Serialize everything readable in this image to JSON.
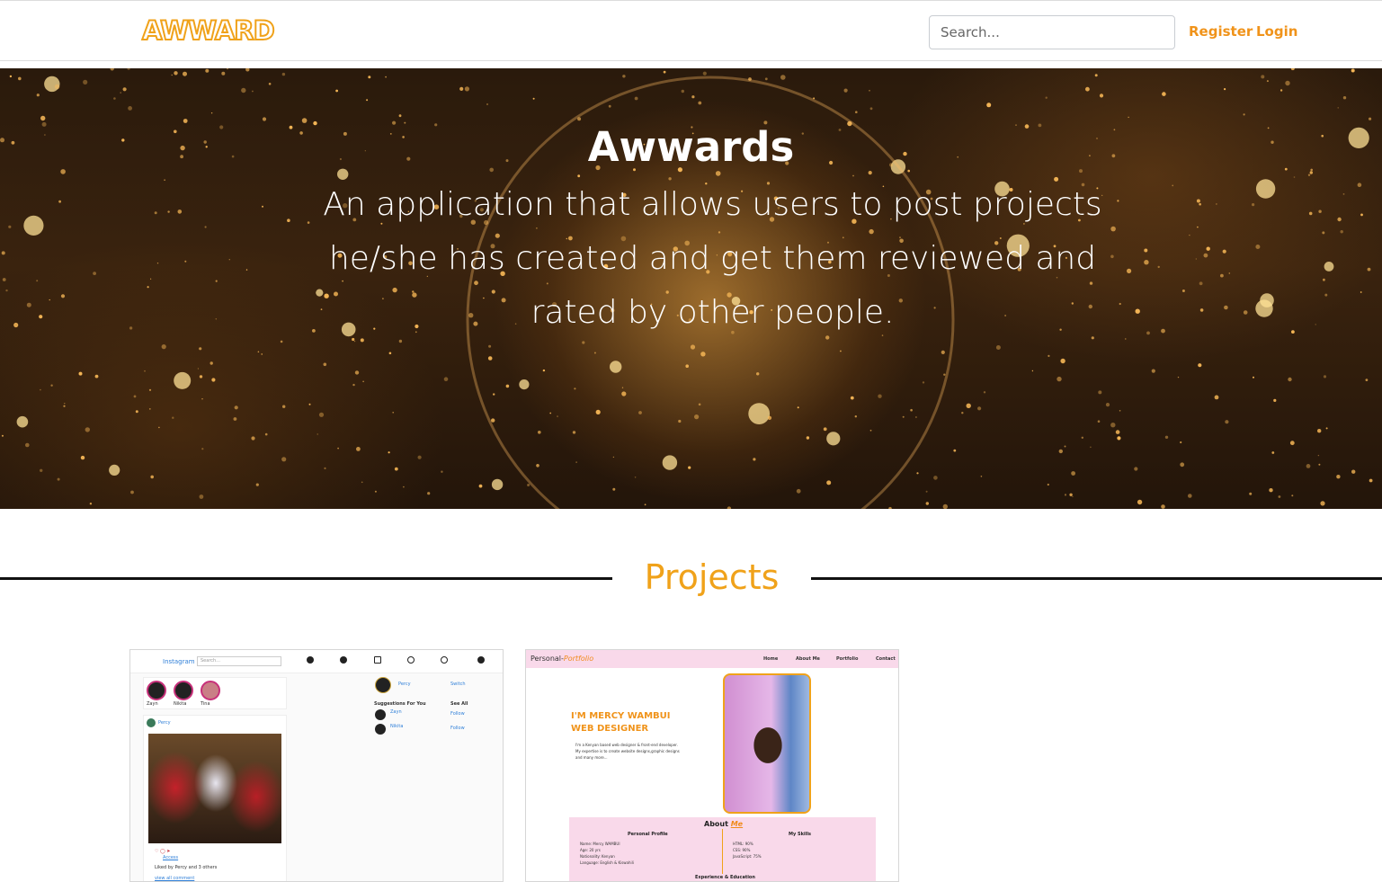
{
  "navbar": {
    "logo": "AWWARD",
    "search_placeholder": "Search...",
    "register": "Register",
    "login": "Login"
  },
  "hero": {
    "title": "Awwards",
    "description": "An application that allows users to post projects he/she has created and get them reviewed and rated by other people."
  },
  "projects": {
    "title": "Projects"
  },
  "cards": [
    {
      "brand": "Instagram",
      "search": "Search...",
      "stories": [
        "Zayn",
        "Nikita",
        "Tina"
      ],
      "post_user": "Percy",
      "side_user": "Percy",
      "side_switch": "Switch",
      "suggestions": "Suggestions For You",
      "see_all": "See All",
      "sugg_1": "Zayn",
      "sugg_2": "Nikita",
      "follow": "Follow",
      "caption_user": "Access",
      "liked_by": "Liked by Percy and 3 others",
      "view_all": "view all comment"
    },
    {
      "brand_a": "Personal-",
      "brand_b": "Portfolio",
      "nav": [
        "Home",
        "About Me",
        "Portfolio",
        "Contact"
      ],
      "heading_1": "I'M MERCY WAMBUI",
      "heading_2": "WEB DESIGNER",
      "intro": "I'm a Kenyan based web designer & front-end developer. My expertise is to create website designs,graphic designs and many more...",
      "about_a": "About ",
      "about_b": "Me",
      "personal_profile": "Personal Profile",
      "my_skills": "My Skills",
      "profile_lines": [
        "Name: Mercy WAMBUI",
        "Age: 20 yrs",
        "Nationality: Kenyan",
        "Language: English & Kiswahili"
      ],
      "skill_lines": [
        "HTML: 90%",
        "CSS: 90%",
        "JavaScript: 75%"
      ],
      "experience": "Experience & Education"
    }
  ],
  "colors": {
    "accent": "#f0931a",
    "heading_orange": "#f0a21a"
  }
}
